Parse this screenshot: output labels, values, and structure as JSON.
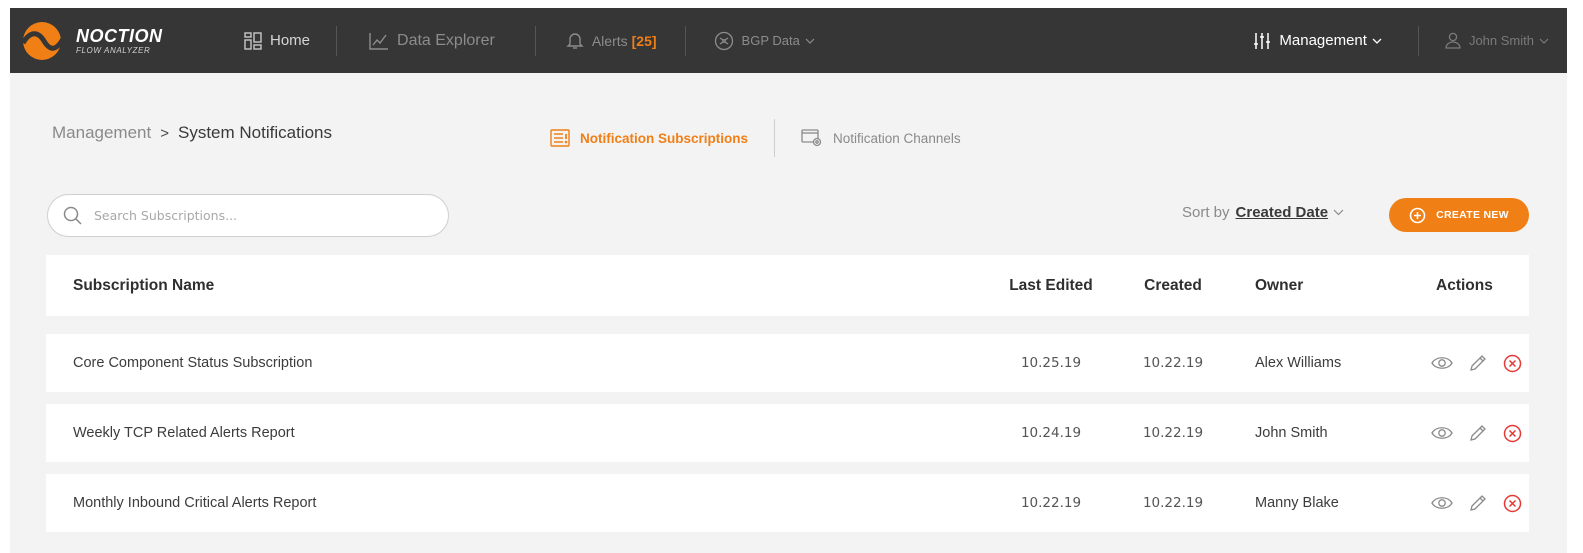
{
  "brand": {
    "name": "NOCTION",
    "subtitle": "FLOW ANALYZER"
  },
  "nav": {
    "home": "Home",
    "data_explorer": "Data Explorer",
    "alerts": "Alerts",
    "alerts_count": "[25]",
    "bgp": "BGP Data",
    "management": "Management",
    "user": "John Smith"
  },
  "breadcrumb": {
    "parent": "Management",
    "separator": ">",
    "current": "System Notifications"
  },
  "tabs": [
    {
      "label": "Notification Subscriptions",
      "active": true
    },
    {
      "label": "Notification Channels",
      "active": false
    }
  ],
  "search": {
    "placeholder": "Search Subscriptions...",
    "value": ""
  },
  "sort": {
    "label": "Sort by",
    "value": "Created Date"
  },
  "create_button": "CREATE NEW",
  "table": {
    "columns": [
      "Subscription Name",
      "Last Edited",
      "Created",
      "Owner",
      "Actions"
    ],
    "rows": [
      {
        "name": "Core Component Status Subscription",
        "last_edited": "10.25.19",
        "created": "10.22.19",
        "owner": "Alex Williams"
      },
      {
        "name": "Weekly TCP Related Alerts Report",
        "last_edited": "10.24.19",
        "created": "10.22.19",
        "owner": "John Smith"
      },
      {
        "name": "Monthly Inbound Critical Alerts Report",
        "last_edited": "10.22.19",
        "created": "10.22.19",
        "owner": "Manny Blake"
      }
    ]
  },
  "colors": {
    "accent": "#f07f16",
    "nav_bg": "#363636",
    "delete": "#e53935",
    "page_bg": "#f3f3f3"
  },
  "icons": [
    "noction-logo-icon",
    "dashboard-icon",
    "line-chart-icon",
    "bell-icon",
    "bgp-icon",
    "chevron-down-icon",
    "sliders-icon",
    "user-icon",
    "list-icon",
    "channel-settings-icon",
    "search-icon",
    "plus-circle-icon",
    "eye-icon",
    "pencil-icon",
    "delete-circle-icon"
  ]
}
